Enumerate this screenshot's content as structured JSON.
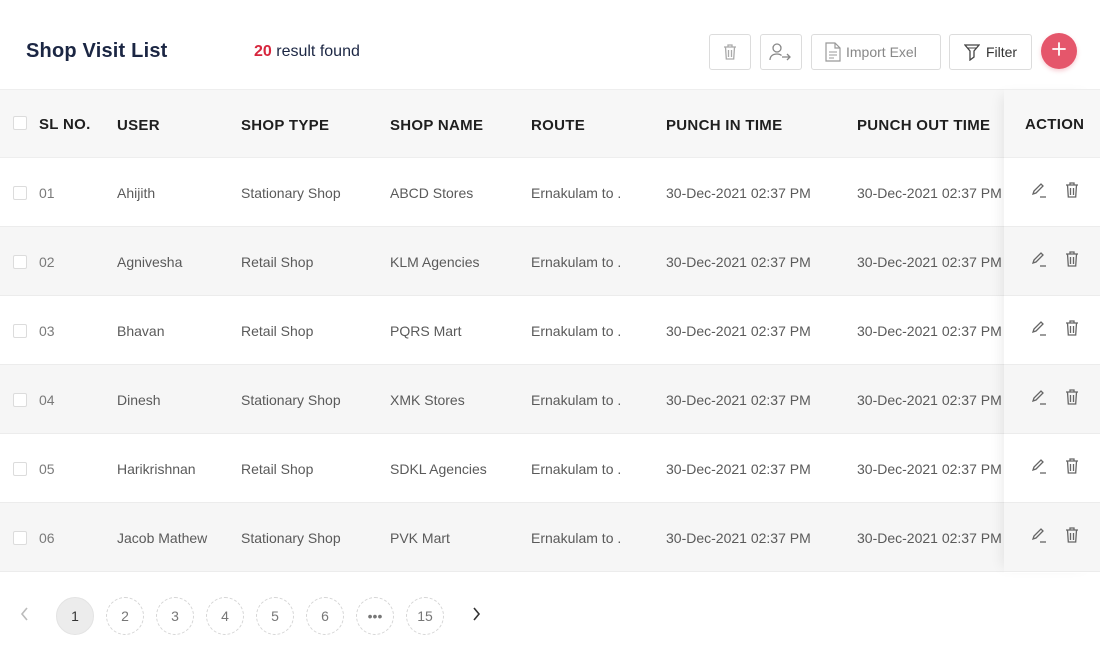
{
  "header": {
    "title": "Shop Visit List",
    "result_count": "20",
    "result_text": "result found"
  },
  "toolbar": {
    "delete_icon": "trash-icon",
    "assign_icon": "user-assign-icon",
    "import_label": "Import Exel",
    "filter_label": "Filter",
    "add_icon": "plus-icon",
    "accent_color": "#e5566b"
  },
  "table": {
    "columns": [
      "SL NO.",
      "USER",
      "SHOP TYPE",
      "SHOP NAME",
      "ROUTE",
      "PUNCH IN TIME",
      "PUNCH OUT TIME",
      "ACTION"
    ],
    "rows": [
      {
        "sl": "01",
        "user": "Ahijith",
        "shop_type": "Stationary Shop",
        "shop_name": "ABCD Stores",
        "route": "Ernakulam to .",
        "punch_in": "30-Dec-2021 02:37 PM",
        "punch_out": "30-Dec-2021 02:37 PM"
      },
      {
        "sl": "02",
        "user": "Agnivesha",
        "shop_type": "Retail Shop",
        "shop_name": "KLM Agencies",
        "route": "Ernakulam to .",
        "punch_in": "30-Dec-2021 02:37 PM",
        "punch_out": "30-Dec-2021 02:37 PM"
      },
      {
        "sl": "03",
        "user": "Bhavan",
        "shop_type": "Retail Shop",
        "shop_name": "PQRS Mart",
        "route": "Ernakulam to .",
        "punch_in": "30-Dec-2021 02:37 PM",
        "punch_out": "30-Dec-2021 02:37 PM"
      },
      {
        "sl": "04",
        "user": "Dinesh",
        "shop_type": "Stationary Shop",
        "shop_name": "XMK Stores",
        "route": "Ernakulam to .",
        "punch_in": "30-Dec-2021 02:37 PM",
        "punch_out": "30-Dec-2021 02:37 PM"
      },
      {
        "sl": "05",
        "user": "Harikrishnan",
        "shop_type": "Retail Shop",
        "shop_name": "SDKL Agencies",
        "route": "Ernakulam to .",
        "punch_in": "30-Dec-2021 02:37 PM",
        "punch_out": "30-Dec-2021 02:37 PM"
      },
      {
        "sl": "06",
        "user": "Jacob Mathew",
        "shop_type": "Stationary Shop",
        "shop_name": "PVK Mart",
        "route": "Ernakulam to .",
        "punch_in": "30-Dec-2021 02:37 PM",
        "punch_out": "30-Dec-2021 02:37 PM"
      }
    ],
    "row_actions": [
      "edit-icon",
      "trash-icon"
    ]
  },
  "pagination": {
    "pages": [
      "1",
      "2",
      "3",
      "4",
      "5",
      "6",
      "•••",
      "15"
    ],
    "current": "1",
    "prev_icon": "chevron-left-icon",
    "next_icon": "chevron-right-icon"
  }
}
